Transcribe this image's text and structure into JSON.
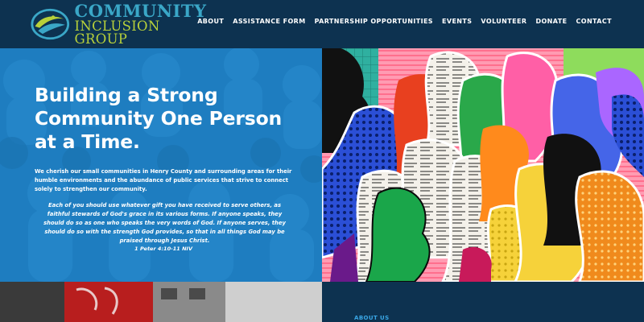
{
  "brand": {
    "name_line1": "COMMUNITY",
    "name_line2": "INCLUSION GROUP",
    "colors": {
      "primary_blue": "#3aa7c7",
      "accent_green": "#b7d03a",
      "navy": "#0d3250"
    }
  },
  "nav": {
    "items": [
      {
        "label": "ABOUT"
      },
      {
        "label": "ASSISTANCE FORM"
      },
      {
        "label": "PARTNERSHIP OPPORTUNITIES"
      },
      {
        "label": "EVENTS"
      },
      {
        "label": "VOLUNTEER"
      },
      {
        "label": "DONATE"
      },
      {
        "label": "CONTACT"
      }
    ]
  },
  "hero": {
    "title": "Building a Strong Community One Person at a Time.",
    "description": "We cherish our small communities in Henry County and surrounding areas for their humble environments and the abundance of public services that strive to connect solely to strengthen our community.",
    "quote": "Each of you should use whatever gift you have received to serve others, as faithful stewards of God's grace in its various forms. If anyone speaks, they should do so as one who speaks the very words of God. If anyone serves, they should do so with the strength God provides, so that in all things God may be praised through Jesus Christ.",
    "citation": "1 Peter 4:10-11 NIV"
  },
  "about": {
    "label": "ABOUT US"
  }
}
